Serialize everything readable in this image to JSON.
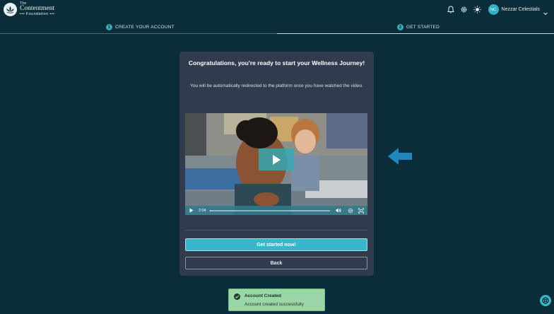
{
  "header": {
    "logo_line1": "The",
    "logo_line2": "Contentment",
    "logo_line3": "••• Foundation •••",
    "user_initials": "NC",
    "user_name": "Nezzar Celestials",
    "icons": [
      "bell-icon",
      "gear-icon",
      "sun-icon",
      "chevron-down-icon"
    ]
  },
  "steps": [
    {
      "number": "1",
      "label": "CREATE YOUR ACCOUNT"
    },
    {
      "number": "2",
      "label": "GET STARTED"
    }
  ],
  "card": {
    "title": "Congratulations, you're ready to start your Wellness Journey!",
    "description": "You will be automatically redirected to the platform once you have watched the video.",
    "video": {
      "time": "2:04",
      "progress": 0.01
    },
    "primary_button": "Get started now!",
    "secondary_button": "Back"
  },
  "toast": {
    "title": "Account Created",
    "message": "Account created successfully"
  },
  "colors": {
    "background": "#0b2c39",
    "accent": "#39b6c9",
    "card": "#313b4d",
    "toast": "#9ad6a6"
  }
}
